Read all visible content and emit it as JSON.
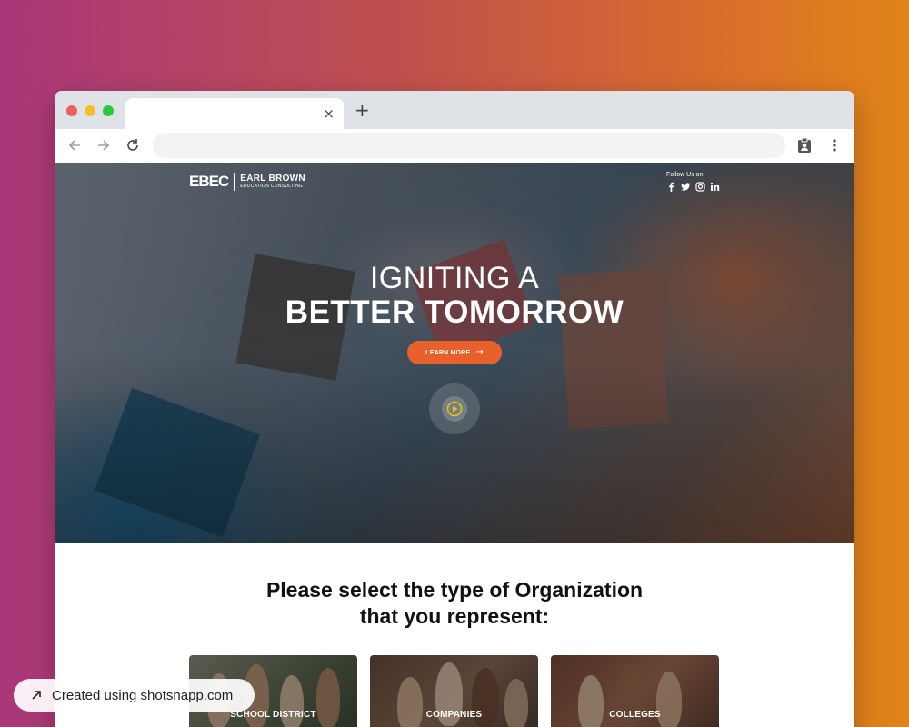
{
  "browser": {
    "tab_close": "×",
    "new_tab": "+"
  },
  "hero": {
    "logo_mark": "EBEC",
    "logo_name": "EARL BROWN",
    "logo_sub": "EDUCATION CONSULTING",
    "follow_label": "Follow Us on",
    "socials": [
      "facebook-icon",
      "twitter-icon",
      "instagram-icon",
      "linkedin-icon"
    ],
    "headline_1": "IGNITING A",
    "headline_2": "BETTER TOMORROW",
    "cta_label": "LEARN MORE",
    "cta_arrow": "→",
    "accent_color": "#e8612c",
    "play_color": "#f2c400"
  },
  "section": {
    "title_line_1": "Please select the type of Organization",
    "title_line_2": "that you represent:"
  },
  "organizations": [
    {
      "label": "SCHOOL DISTRICT"
    },
    {
      "label": "COMPANIES"
    },
    {
      "label": "COLLEGES"
    }
  ],
  "watermark": {
    "text": "Created using shotsnapp.com"
  }
}
